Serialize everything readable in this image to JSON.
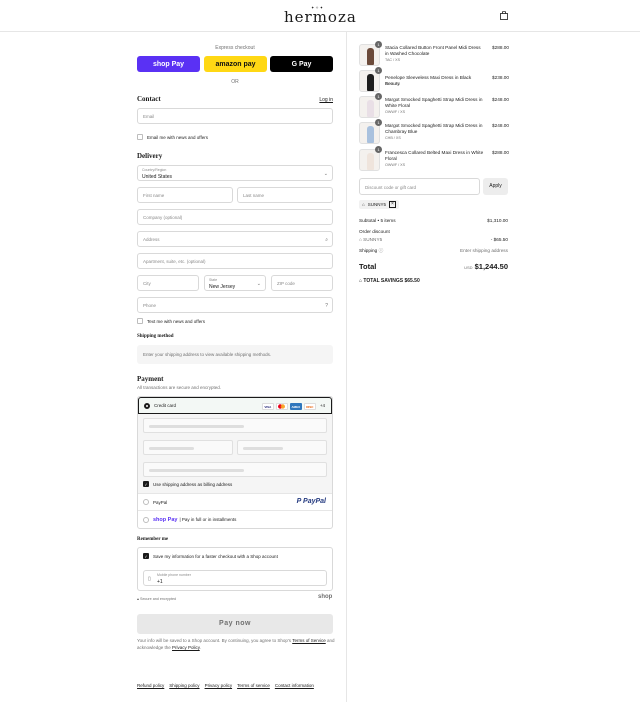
{
  "header": {
    "logo": "hermoza",
    "logo_stars": "✦✧✦",
    "bag_icon": "shopping-bag-icon"
  },
  "express": {
    "title": "Express checkout",
    "shop_pay": "shop Pay",
    "amazon_pay": "amazon pay",
    "google_pay": "G Pay",
    "or": "OR"
  },
  "contact": {
    "title": "Contact",
    "login": "Log in",
    "email_placeholder": "Email",
    "email_offers": "Email me with news and offers"
  },
  "delivery": {
    "title": "Delivery",
    "country_label": "Country/Region",
    "country_value": "United States",
    "first_name": "First name",
    "last_name": "Last name",
    "company": "Company (optional)",
    "address": "Address",
    "apartment": "Apartment, suite, etc. (optional)",
    "city": "City",
    "state_label": "State",
    "state_value": "New Jersey",
    "zip": "ZIP code",
    "phone": "Phone",
    "text_offers": "Text me with news and offers"
  },
  "shipping_method": {
    "title": "Shipping method",
    "placeholder": "Enter your shipping address to view available shipping methods."
  },
  "payment": {
    "title": "Payment",
    "subtitle": "All transactions are secure and encrypted.",
    "credit_card": "Credit card",
    "more_cards": "+4",
    "card_brands": [
      "VISA",
      "MC",
      "AMEX",
      "DISC"
    ],
    "use_shipping": "Use shipping address as billing address",
    "paypal": "PayPal",
    "paypal_logo": "P PayPal",
    "shop_pay_badge": "shop Pay",
    "shop_pay_text": "| Pay in full or in installments"
  },
  "remember": {
    "title": "Remember me",
    "save_info": "Save my information for a faster checkout with a Shop account",
    "mobile_label": "Mobile phone number",
    "mobile_value": "+1",
    "secure": "Secure and encrypted",
    "shop_logo": "shop"
  },
  "pay_now": "Pay now",
  "legal": {
    "text_1": "Your info will be saved to a Shop account. By continuing, you agree to Shop's ",
    "terms": "Terms of Service",
    "text_2": " and acknowledge the ",
    "privacy": "Privacy Policy",
    "text_3": "."
  },
  "footer_links": [
    "Refund policy",
    "Shipping policy",
    "Privacy policy",
    "Terms of service",
    "Contact information"
  ],
  "cart": {
    "items": [
      {
        "name": "Stacia Collared Button Front Panel Midi Dress in Washed Chocolate",
        "variant": "TAC / XS",
        "price": "$288.00",
        "qty": "1",
        "color": "#6b4a3a"
      },
      {
        "name": "Penelope Sleeveless Maxi Dress in Black Beauty",
        "variant": "BLK / XS",
        "price": "$238.00",
        "qty": "1",
        "color": "#1e1e1e"
      },
      {
        "name": "Margot Smocked Spaghetti Strap Midi Dress in White Floral",
        "variant": "OWWF / XS",
        "price": "$248.00",
        "qty": "1",
        "color": "#e9dfe6"
      },
      {
        "name": "Margot Smocked Spaghetti Strap Midi Dress in Chambray Blue",
        "variant": "CHB / XS",
        "price": "$248.00",
        "qty": "1",
        "color": "#a9c1de"
      },
      {
        "name": "Francesca Collared Belted Maxi Dress in White Floral",
        "variant": "OWWF / XS",
        "price": "$288.00",
        "qty": "1",
        "color": "#efe4dc"
      }
    ],
    "discount_placeholder": "Discount code or gift card",
    "apply": "Apply",
    "code": "SUNNY5",
    "subtotal_label": "Subtotal • 5 items",
    "subtotal": "$1,310.00",
    "order_discount": "Order discount",
    "discount_code": "SUNNY5",
    "discount_amount": "- $65.50",
    "shipping_label": "Shipping",
    "shipping_value": "Enter shipping address",
    "total_label": "Total",
    "currency": "USD",
    "total": "$1,244.50",
    "total_savings_label": "TOTAL SAVINGS",
    "total_savings": "$65.50"
  }
}
